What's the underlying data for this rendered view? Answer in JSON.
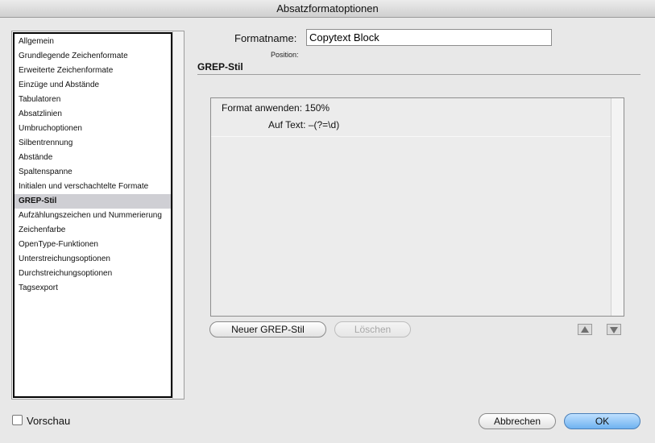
{
  "window": {
    "title": "Absatzformatoptionen"
  },
  "sidebar": {
    "items": [
      {
        "label": "Allgemein"
      },
      {
        "label": "Grundlegende Zeichenformate"
      },
      {
        "label": "Erweiterte Zeichenformate"
      },
      {
        "label": "Einzüge und Abstände"
      },
      {
        "label": "Tabulatoren"
      },
      {
        "label": "Absatzlinien"
      },
      {
        "label": "Umbruchoptionen"
      },
      {
        "label": "Silbentrennung"
      },
      {
        "label": "Abstände"
      },
      {
        "label": "Spaltenspanne"
      },
      {
        "label": "Initialen und verschachtelte Formate"
      },
      {
        "label": "GREP-Stil",
        "selected": true
      },
      {
        "label": "Aufzählungszeichen und Nummerierung"
      },
      {
        "label": "Zeichenfarbe"
      },
      {
        "label": "OpenType-Funktionen"
      },
      {
        "label": "Unterstreichungsoptionen"
      },
      {
        "label": "Durchstreichungsoptionen"
      },
      {
        "label": "Tagsexport"
      }
    ]
  },
  "format": {
    "name_label": "Formatname:",
    "name_value": "Copytext Block",
    "position_label": "Position:"
  },
  "section": {
    "title": "GREP-Stil"
  },
  "grep": {
    "apply_label": "Format anwenden:",
    "apply_value": "150%",
    "text_label": "Auf Text:",
    "text_value": "–(?=\\d)"
  },
  "buttons": {
    "new_grep": "Neuer GREP-Stil",
    "delete": "Löschen",
    "cancel": "Abbrechen",
    "ok": "OK"
  },
  "preview": {
    "label": "Vorschau",
    "checked": false
  },
  "icons": {
    "move_up": "arrow-up-icon",
    "move_down": "arrow-down-icon"
  }
}
